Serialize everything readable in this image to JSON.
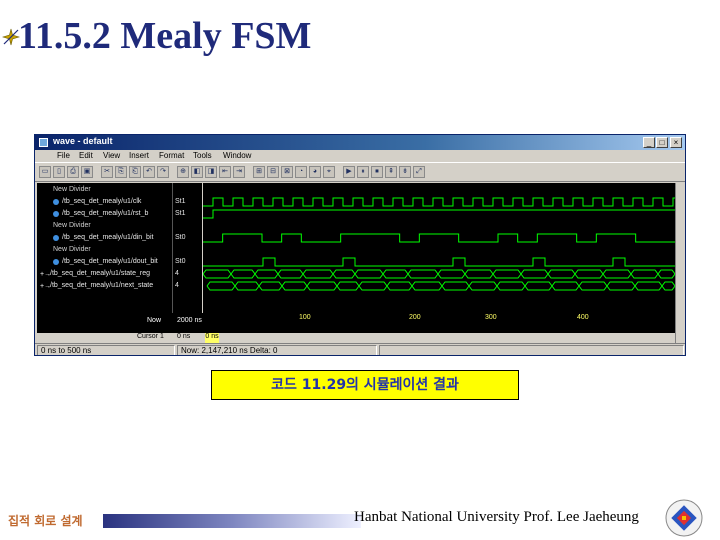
{
  "slide": {
    "title": "11.5.2 Mealy FSM",
    "caption": "코드 11.29의 시뮬레이션 결과",
    "footer_left": "집적 회로 설계",
    "footer_right": "Hanbat National University Prof. Lee Jaeheung"
  },
  "window": {
    "title": "wave - default",
    "menu": [
      "File",
      "Edit",
      "View",
      "Insert",
      "Format",
      "Tools",
      "Window"
    ],
    "signals": [
      {
        "kind": "divider",
        "label": "New Divider"
      },
      {
        "kind": "signal",
        "label": "/tb_seq_det_mealy/u1/clk",
        "value": "St1"
      },
      {
        "kind": "signal",
        "label": "/tb_seq_det_mealy/u1/rst_b",
        "value": "St1"
      },
      {
        "kind": "divider",
        "label": "New Divider"
      },
      {
        "kind": "signal",
        "label": "/tb_seq_det_mealy/u1/din_bit",
        "value": "St0"
      },
      {
        "kind": "divider",
        "label": "New Divider"
      },
      {
        "kind": "signal",
        "label": "/tb_seq_det_mealy/u1/dout_bit",
        "value": "St0"
      },
      {
        "kind": "bus",
        "label": "/tb_seq_det_mealy/u1/state_reg",
        "value": "4"
      },
      {
        "kind": "bus",
        "label": "/tb_seq_det_mealy/u1/next_state",
        "value": "4"
      }
    ],
    "cursor": {
      "name": "Now",
      "value": "2000 ns",
      "row2_label": "Cursor 1",
      "row2_value": "0 ns",
      "tag": "0 ns"
    },
    "time_labels": [
      "100",
      "200",
      "300",
      "400"
    ],
    "status": [
      "0 ns to 500 ns",
      "Now: 2,147,210 ns  Delta: 0"
    ]
  },
  "colors": {
    "title": "#1f2a7a",
    "wave": "#00ff00",
    "caption_bg": "#ffff00",
    "caption_text": "#2233aa",
    "footer_left": "#c06a30"
  }
}
